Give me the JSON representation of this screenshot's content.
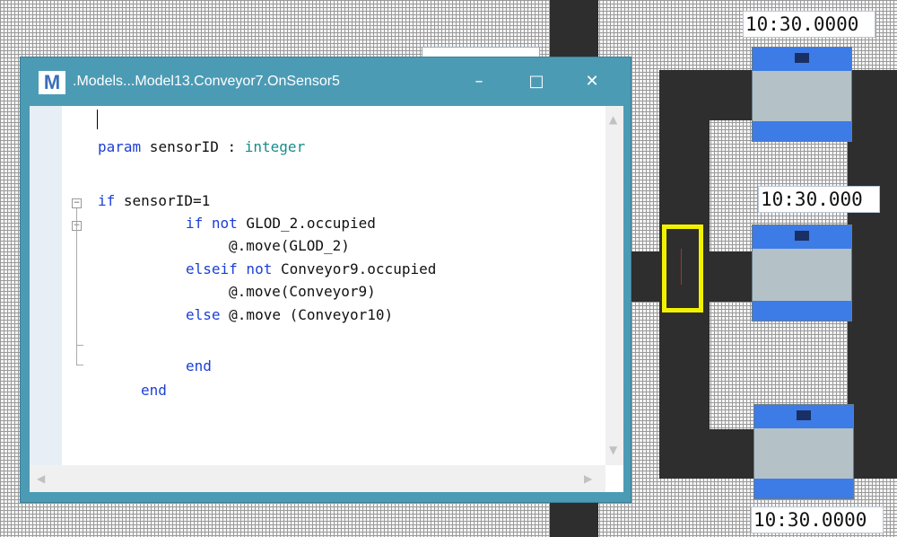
{
  "window": {
    "logo": "M",
    "title": ".Models...Model13.Conveyor7.OnSensor5",
    "min_label": "–",
    "max_label": "□",
    "close_label": "✕"
  },
  "code": {
    "line1": "param sensorID : integer",
    "line1_kw": "param",
    "line1_rest": " sensorID : ",
    "line1_type": "integer",
    "if_kw": "if",
    "if_rest": " sensorID=1",
    "ifnot_kw": "if not",
    "ifnot_rest": " GLOD_2.occupied",
    "move1": "@.move(GLOD_2)",
    "elseif_kw": "elseif not",
    "elseif_rest": " Conveyor9.occupied",
    "move2": "@.move(Conveyor9)",
    "else_kw": "else",
    "else_rest": " @.move (Conveyor10)",
    "end1": "end",
    "end2": "end"
  },
  "timers": {
    "top": "10:30.0000",
    "middle": "10:30.000",
    "bottom": "10:30.0000"
  },
  "colors": {
    "window_frame": "#4c9bb5",
    "keyword": "#1c3fd6",
    "type": "#178c8c",
    "station_blue": "#3d7be6",
    "sensor_highlight": "#ffff00"
  },
  "icons": {
    "logo": "app-logo-icon",
    "minimize": "minimize-icon",
    "maximize": "maximize-icon",
    "close": "close-icon"
  }
}
